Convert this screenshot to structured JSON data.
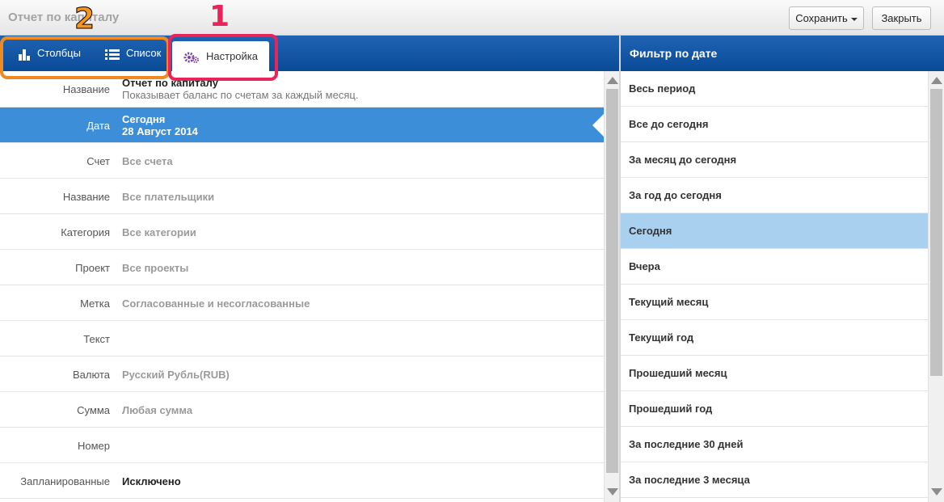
{
  "window": {
    "title": "Отчет по капиталу",
    "save_label": "Сохранить",
    "close_label": "Закрыть"
  },
  "tabs": [
    {
      "label": "Столбцы",
      "icon": "bar-chart-icon"
    },
    {
      "label": "Список",
      "icon": "list-icon"
    },
    {
      "label": "Настройка",
      "icon": "gears-icon"
    }
  ],
  "annotations": {
    "one": "1",
    "two": "2",
    "color_one": "#e8245a",
    "color_two": "#f7941d"
  },
  "settings": [
    {
      "label": "Название",
      "line1": "Отчет по капиталу",
      "line2": "Показывает баланс по счетам за каждый месяц."
    },
    {
      "label": "Дата",
      "line1": "Сегодня",
      "line2": "28 Август 2014",
      "selected": true
    },
    {
      "label": "Счет",
      "value": "Все счета"
    },
    {
      "label": "Название",
      "value": "Все плательщики"
    },
    {
      "label": "Категория",
      "value": "Все категории"
    },
    {
      "label": "Проект",
      "value": "Все проекты"
    },
    {
      "label": "Метка",
      "value": "Согласованные и несогласованные"
    },
    {
      "label": "Текст",
      "value": ""
    },
    {
      "label": "Валюта",
      "value": "Русский Рубль(RUB)"
    },
    {
      "label": "Сумма",
      "value": "Любая сумма"
    },
    {
      "label": "Номер",
      "value": ""
    },
    {
      "label": "Запланированные",
      "value": "Исключено",
      "dark": true
    }
  ],
  "date_filter": {
    "title": "Фильтр по дате",
    "options": [
      "Весь период",
      "Все до сегодня",
      "За месяц до сегодня",
      "За год до сегодня",
      "Сегодня",
      "Вчера",
      "Текущий месяц",
      "Текущий год",
      "Прошедший месяц",
      "Прошедший год",
      "За последние 30 дней",
      "За последние 3 месяца"
    ],
    "selected": "Сегодня"
  },
  "colors": {
    "header_blue": "#0a4b97",
    "selected_row": "#3c8ed8",
    "selected_filter": "#a9d0ef"
  }
}
